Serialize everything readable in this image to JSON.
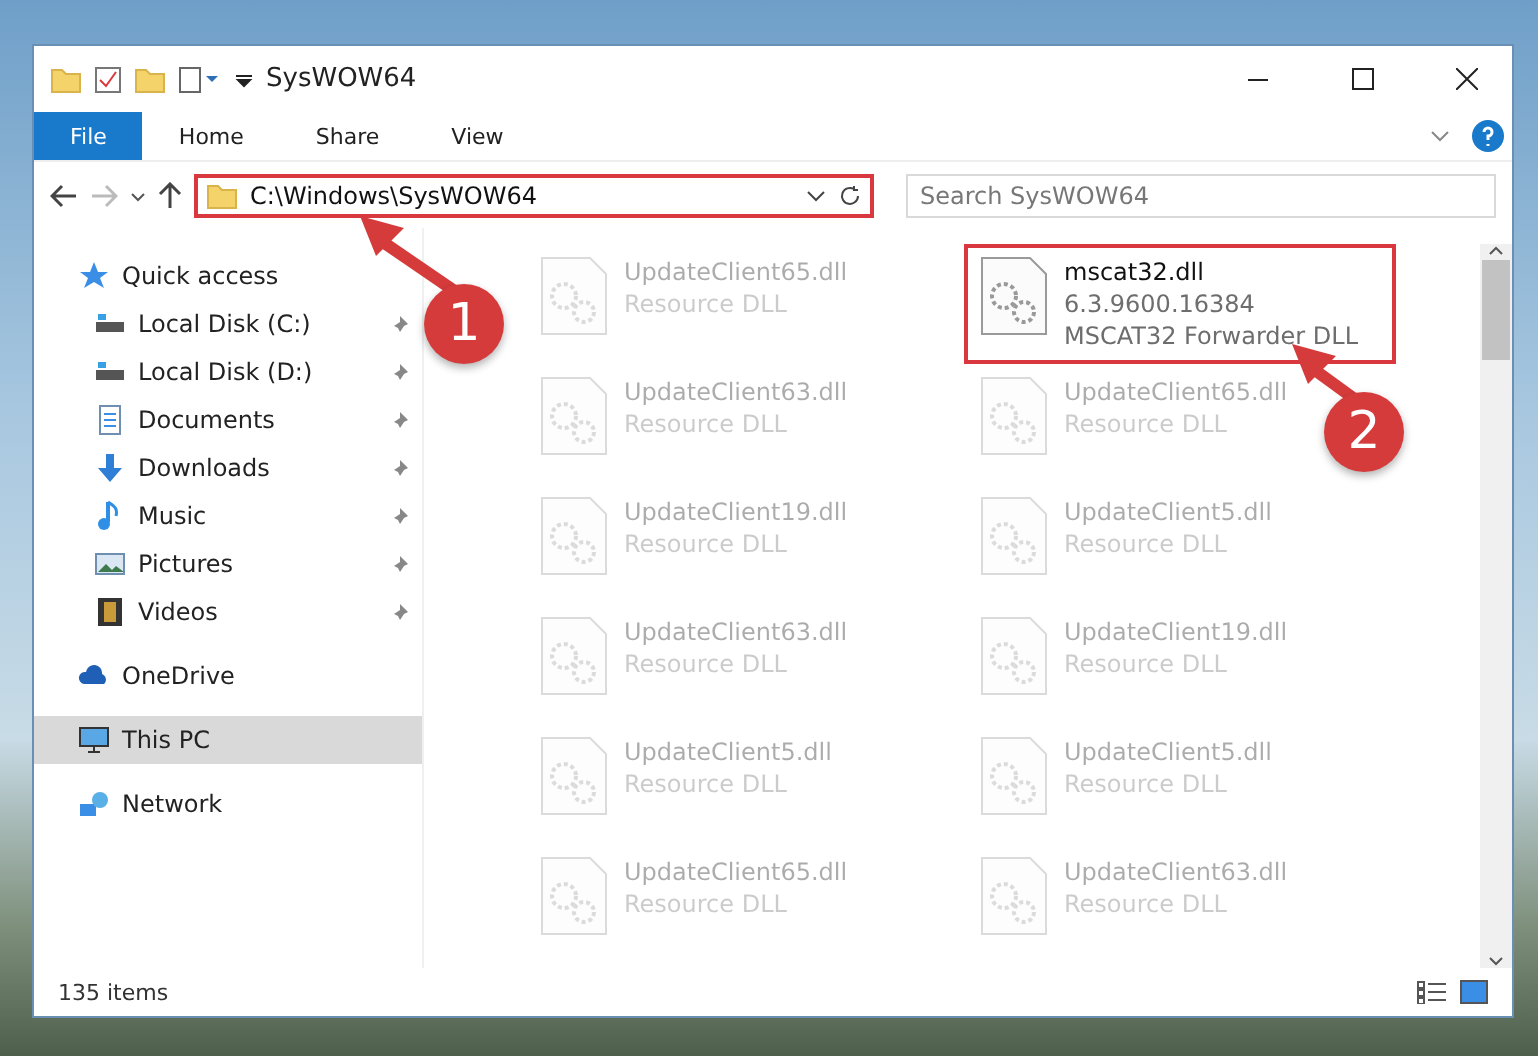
{
  "window": {
    "title": "SysWOW64"
  },
  "ribbon_tabs": [
    {
      "label": "File",
      "selected": true
    },
    {
      "label": "Home",
      "selected": false
    },
    {
      "label": "Share",
      "selected": false
    },
    {
      "label": "View",
      "selected": false
    }
  ],
  "address_bar": {
    "path": "C:\\Windows\\SysWOW64",
    "highlighted": true
  },
  "search": {
    "placeholder": "Search SysWOW64"
  },
  "sidebar": {
    "items": [
      {
        "label": "Quick access",
        "kind": "star",
        "selected": false,
        "pinned": false,
        "children": [
          {
            "label": "Local Disk (C:)",
            "kind": "drive",
            "selected": false,
            "pinned": true
          },
          {
            "label": "Local Disk (D:)",
            "kind": "drive",
            "selected": false,
            "pinned": true
          },
          {
            "label": "Documents",
            "kind": "doc",
            "selected": false,
            "pinned": true
          },
          {
            "label": "Downloads",
            "kind": "download",
            "selected": false,
            "pinned": true
          },
          {
            "label": "Music",
            "kind": "music",
            "selected": false,
            "pinned": true
          },
          {
            "label": "Pictures",
            "kind": "picture",
            "selected": false,
            "pinned": true
          },
          {
            "label": "Videos",
            "kind": "video",
            "selected": false,
            "pinned": true
          }
        ]
      },
      {
        "label": "OneDrive",
        "kind": "cloud",
        "selected": false,
        "pinned": false
      },
      {
        "label": "This PC",
        "kind": "pc",
        "selected": true,
        "pinned": false
      },
      {
        "label": "Network",
        "kind": "network",
        "selected": false,
        "pinned": false
      }
    ]
  },
  "files": {
    "columns": [
      [
        {
          "name": "UpdateClient65.dll",
          "type": "Resource DLL",
          "highlighted": false
        },
        {
          "name": "UpdateClient63.dll",
          "type": "Resource DLL",
          "highlighted": false
        },
        {
          "name": "UpdateClient19.dll",
          "type": "Resource DLL",
          "highlighted": false
        },
        {
          "name": "UpdateClient63.dll",
          "type": "Resource DLL",
          "highlighted": false
        },
        {
          "name": "UpdateClient5.dll",
          "type": "Resource DLL",
          "highlighted": false
        },
        {
          "name": "UpdateClient65.dll",
          "type": "Resource DLL",
          "highlighted": false
        }
      ],
      [
        {
          "name": "mscat32.dll",
          "version": "6.3.9600.16384",
          "type": "MSCAT32 Forwarder DLL",
          "highlighted": true
        },
        {
          "name": "UpdateClient65.dll",
          "type": "Resource DLL",
          "highlighted": false
        },
        {
          "name": "UpdateClient5.dll",
          "type": "Resource DLL",
          "highlighted": false
        },
        {
          "name": "UpdateClient19.dll",
          "type": "Resource DLL",
          "highlighted": false
        },
        {
          "name": "UpdateClient5.dll",
          "type": "Resource DLL",
          "highlighted": false
        },
        {
          "name": "UpdateClient63.dll",
          "type": "Resource DLL",
          "highlighted": false
        }
      ]
    ]
  },
  "status_bar": {
    "count": "135 items"
  },
  "annotations": [
    {
      "number": "1"
    },
    {
      "number": "2"
    }
  ]
}
